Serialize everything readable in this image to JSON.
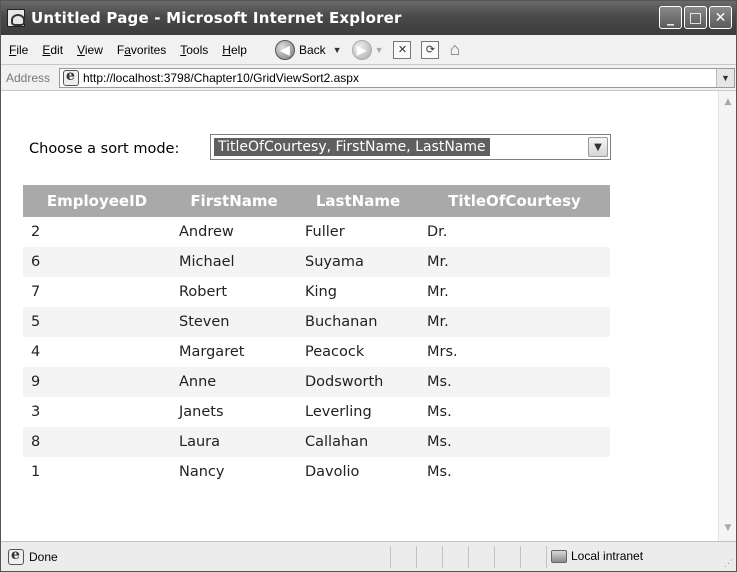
{
  "window": {
    "title": "Untitled Page - Microsoft Internet Explorer",
    "buttons": {
      "minimize": "_",
      "maximize": "□",
      "close": "✕"
    }
  },
  "menu": {
    "items": [
      {
        "pre": "",
        "key": "F",
        "post": "ile"
      },
      {
        "pre": "",
        "key": "E",
        "post": "dit"
      },
      {
        "pre": "",
        "key": "V",
        "post": "iew"
      },
      {
        "pre": "F",
        "key": "a",
        "post": "vorites"
      },
      {
        "pre": "",
        "key": "T",
        "post": "ools"
      },
      {
        "pre": "",
        "key": "H",
        "post": "elp"
      }
    ],
    "back_label": "Back",
    "overflow": "»"
  },
  "address": {
    "label": "Address",
    "url": "http://localhost:3798/Chapter10/GridViewSort2.aspx"
  },
  "page": {
    "sort_label": "Choose a sort mode:",
    "sort_selected": "TitleOfCourtesy, FirstName, LastName"
  },
  "grid": {
    "headers": [
      "EmployeeID",
      "FirstName",
      "LastName",
      "TitleOfCourtesy"
    ],
    "rows": [
      [
        "2",
        "Andrew",
        "Fuller",
        "Dr."
      ],
      [
        "6",
        "Michael",
        "Suyama",
        "Mr."
      ],
      [
        "7",
        "Robert",
        "King",
        "Mr."
      ],
      [
        "5",
        "Steven",
        "Buchanan",
        "Mr."
      ],
      [
        "4",
        "Margaret",
        "Peacock",
        "Mrs."
      ],
      [
        "9",
        "Anne",
        "Dodsworth",
        "Ms."
      ],
      [
        "3",
        "Janets",
        "Leverling",
        "Ms."
      ],
      [
        "8",
        "Laura",
        "Callahan",
        "Ms."
      ],
      [
        "1",
        "Nancy",
        "Davolio",
        "Ms."
      ]
    ]
  },
  "status": {
    "text": "Done",
    "zone": "Local intranet"
  },
  "colors": {
    "header_bg": "#a9a9a9",
    "alt_row_bg": "#f4f4f4",
    "selection_bg": "#5f5f5f"
  },
  "icons": {
    "title": "ie-page-icon",
    "back": "back-arrow-icon",
    "forward": "forward-arrow-icon",
    "stop": "stop-icon",
    "refresh": "refresh-icon",
    "home": "home-icon",
    "windows_logo": "windows-logo-icon",
    "zone": "intranet-zone-icon"
  }
}
